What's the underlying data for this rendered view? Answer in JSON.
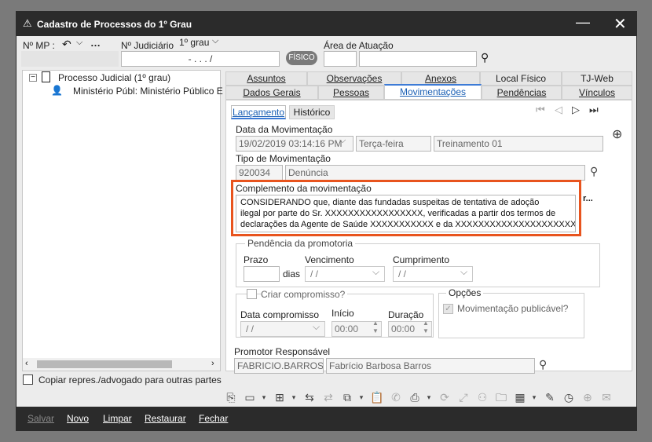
{
  "window": {
    "title": "Cadastro de Processos do 1º Grau",
    "minimize_icon": "minimize-icon",
    "close_icon": "close-icon"
  },
  "header": {
    "nmp_label": "Nº MP :",
    "judiciario_label": "Nº Judiciário",
    "grau_value": "1º grau",
    "processo_mask": "-  .   .  .   /",
    "fisico_label": "FÍSICO",
    "area_label": "Área de Atuação"
  },
  "tree": {
    "root_label": "Processo Judicial (1º grau)",
    "child_label": "Ministério Públ: Ministério Público E"
  },
  "copy_checkbox_label": "Copiar repres./advogado para outras partes",
  "tabs_row1": [
    "Assuntos",
    "Observações",
    "Anexos",
    "Local Físico",
    "TJ-Web"
  ],
  "tabs_row2": [
    "Dados Gerais",
    "Pessoas",
    "Movimentações",
    "Pendências",
    "Vínculos"
  ],
  "subtabs": [
    "Lançamento",
    "Histórico"
  ],
  "form": {
    "data_label": "Data da Movimentação",
    "data_value": "19/02/2019 03:14:16 PM",
    "weekday_value": "Terça-feira",
    "user_value": "Treinamento 01",
    "tipo_label": "Tipo de Movimentação",
    "tipo_code": "920034",
    "tipo_desc": "Denúncia",
    "complemento_label": "Complemento da movimentação",
    "complemento_lines": [
      "CONSIDERANDO que, diante das fundadas suspeitas de tentativa de adoção",
      "ilegal por parte do Sr. XXXXXXXXXXXXXXXXX, verificadas a partir dos termos de",
      "declarações da Agente de Saúde XXXXXXXXXXX e da XXXXXXXXXXXXXXXXXXXXXX, e"
    ],
    "complemento_overflow": "r...",
    "pendencia_group": "Pendência da promotoria",
    "prazo_label": "Prazo",
    "dias_label": "dias",
    "vencimento_label": "Vencimento",
    "vencimento_value": "/  /",
    "cumprimento_label": "Cumprimento",
    "cumprimento_value": "/  /",
    "criar_label": "Criar compromisso?",
    "data_compromisso_label": "Data compromisso",
    "data_compromisso_value": "/  /",
    "inicio_label": "Início",
    "inicio_value": "00:00",
    "duracao_label": "Duração",
    "duracao_value": "00:00",
    "opcoes_label": "Opções",
    "publicavel_label": "Movimentação publicável?",
    "promotor_label": "Promotor Responsável",
    "promotor_login": "FABRICIO.BARROS",
    "promotor_nome": "Fabrício Barbosa Barros"
  },
  "bottom_buttons": [
    "Salvar",
    "Novo",
    "Limpar",
    "Restaurar",
    "Fechar"
  ],
  "accent_color": "#e8541e"
}
